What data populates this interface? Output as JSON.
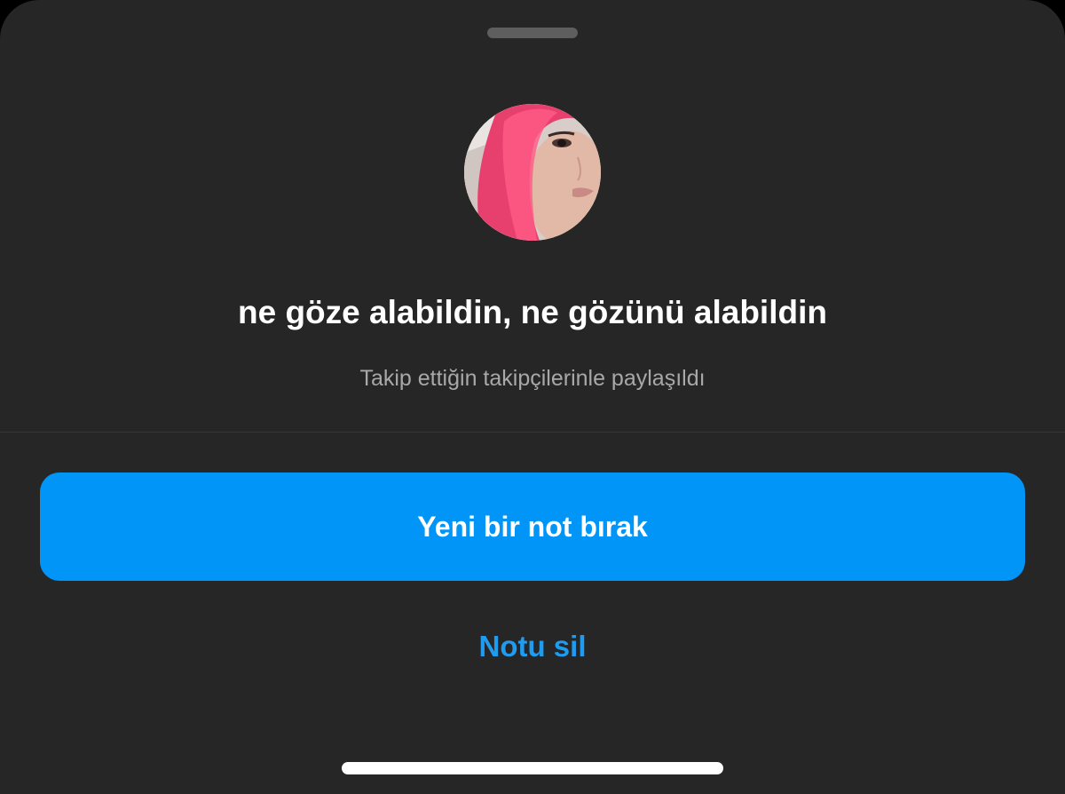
{
  "sheet": {
    "note_text": "ne göze alabildin, ne gözünü alabildin",
    "audience_text": "Takip ettiğin takipçilerinle paylaşıldı",
    "avatar_icon": "profile-photo"
  },
  "actions": {
    "primary_label": "Yeni bir not bırak",
    "secondary_label": "Notu sil"
  },
  "colors": {
    "sheet_background": "#262626",
    "primary_button": "#0095f6",
    "secondary_text": "#1f9bf0",
    "subtitle_text": "#a8a8a8"
  }
}
